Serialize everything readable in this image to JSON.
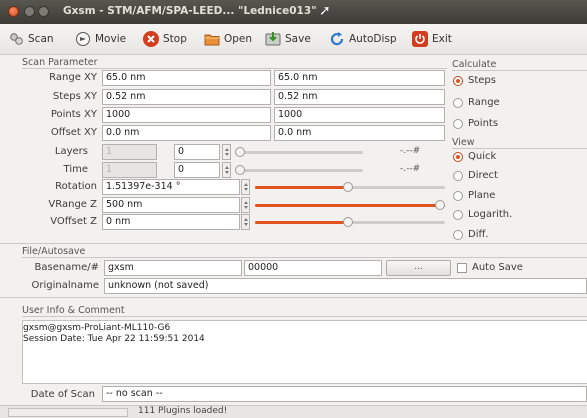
{
  "window": {
    "title": "Gxsm - STM/AFM/SPA-LEED... \"Lednice013\""
  },
  "toolbar": {
    "scan": "Scan",
    "movie": "Movie",
    "stop": "Stop",
    "open": "Open",
    "save": "Save",
    "autodisp": "AutoDisp",
    "exit": "Exit"
  },
  "scan_parameter": {
    "title": "Scan Parameter",
    "rows": [
      {
        "label": "Range XY",
        "x": "65.0 nm",
        "y": "65.0 nm"
      },
      {
        "label": "Steps XY",
        "x": "0.52 nm",
        "y": "0.52 nm"
      },
      {
        "label": "Points XY",
        "x": "1000",
        "y": "1000"
      },
      {
        "label": "Offset XY",
        "x": "0.0 nm",
        "y": "0.0 nm"
      }
    ],
    "layers": {
      "label": "Layers",
      "value": "1",
      "index": "0",
      "readout": "-.--#"
    },
    "time": {
      "label": "Time",
      "value": "1",
      "index": "0",
      "readout": "-.--#"
    },
    "rotation": {
      "label": "Rotation",
      "value": "1.51397e-314 °",
      "level": 0.49
    },
    "vrange": {
      "label": "VRange Z",
      "value": "500 nm",
      "level": 1.0
    },
    "voffset": {
      "label": "VOffset Z",
      "value": "0 nm",
      "level": 0.49
    }
  },
  "calculate": {
    "title": "Calculate",
    "options": [
      "Steps",
      "Range",
      "Points"
    ],
    "selected": "Steps"
  },
  "view": {
    "title": "View",
    "options": [
      "Quick",
      "Direct",
      "Plane",
      "Logarith.",
      "Diff."
    ],
    "selected": "Quick"
  },
  "file_autosave": {
    "title": "File/Autosave",
    "basename_label": "Basename/#",
    "basename": "gxsm",
    "number": "00000",
    "browse": "...",
    "autosave_label": "Auto Save",
    "originalname_label": "Originalname",
    "originalname": "unknown (not saved)"
  },
  "user_info": {
    "title": "User Info & Comment",
    "lines": [
      "gxsm@gxsm-ProLiant-ML110-G6",
      "Session Date: Tue Apr 22 11:59:51 2014"
    ]
  },
  "date_of_scan": {
    "label": "Date of Scan",
    "value": "-- no scan --"
  },
  "status": {
    "message": "111 Plugins loaded!"
  },
  "colors": {
    "accent": "#e0531f",
    "titlebar": "#3c3b37"
  }
}
